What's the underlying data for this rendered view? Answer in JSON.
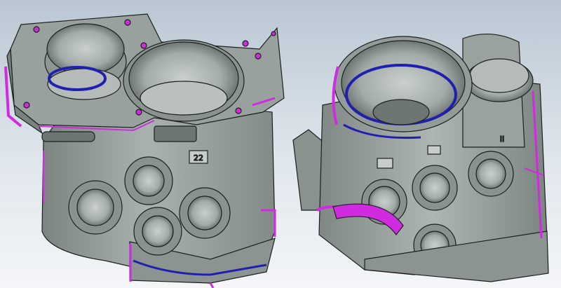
{
  "viewport": {
    "name": "3d-cad-viewport",
    "background_top": "#b9c7d3",
    "background_bottom": "#f4f6f8"
  },
  "model_left": {
    "name": "valve-housing-left-view",
    "body_color": "#9fa7a4",
    "edge_color": "#1c1f1e",
    "highlight_magenta": "#d12be0",
    "highlight_blue": "#2020b0",
    "engraved_text": "22"
  },
  "model_right": {
    "name": "valve-housing-right-view",
    "body_color": "#9fa7a4",
    "edge_color": "#1c1f1e",
    "highlight_magenta": "#d12be0",
    "highlight_blue": "#2020b0",
    "engraved_text": "II"
  }
}
